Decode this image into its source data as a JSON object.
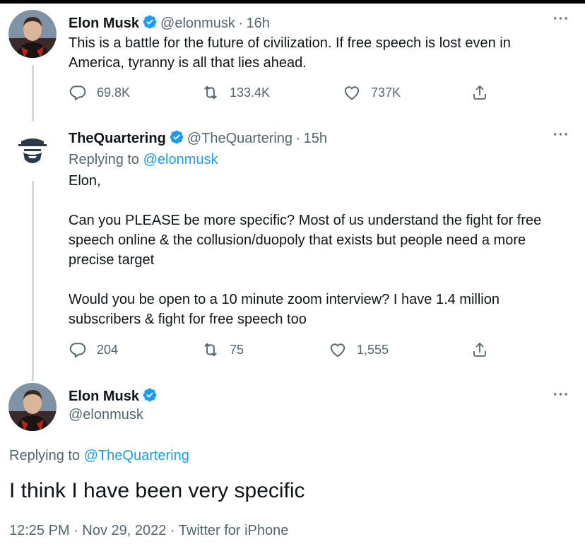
{
  "tweet1": {
    "name": "Elon Musk",
    "handle": "@elonmusk",
    "separator": "·",
    "time": "16h",
    "more": "···",
    "text_line1": "This is a battle for the future of civilization. If free speech is lost even in",
    "text_line2": "America, tyranny is all that lies ahead.",
    "replies": "69.8K",
    "retweets": "133.4K",
    "likes": "737K"
  },
  "tweet2": {
    "name": "TheQuartering",
    "handle": "@TheQuartering",
    "separator": "·",
    "time": "15h",
    "more": "···",
    "replying_prefix": "Replying to",
    "replying_handle": "@elonmusk",
    "para1": "Elon,",
    "para2_line1": "Can you PLEASE be more specific?  Most of us understand the fight for free",
    "para2_line2": "speech online &  the collusion/duopoly that exists but people need a more",
    "para2_line3": "precise target",
    "para3_line1": "Would you be open to a 10 minute zoom interview?  I have 1.4 million",
    "para3_line2": "subscribers & fight for free speech too",
    "replies": "204",
    "retweets": "75",
    "likes": "1,555"
  },
  "tweet3": {
    "name": "Elon Musk",
    "handle": "@elonmusk",
    "more": "···",
    "replying_prefix": "Replying to",
    "replying_handle": "@TheQuartering",
    "text": "I think I have been very specific",
    "timestamp": "12:25 PM · Nov 29, 2022 · Twitter for iPhone"
  },
  "colors": {
    "verified": "#1d9bf0",
    "link": "#1d9bf0",
    "muted": "#536471",
    "thread_line": "#cfd9de"
  },
  "icons": [
    "reply-icon",
    "retweet-icon",
    "like-icon",
    "share-icon",
    "more-icon",
    "verified-badge-icon"
  ]
}
